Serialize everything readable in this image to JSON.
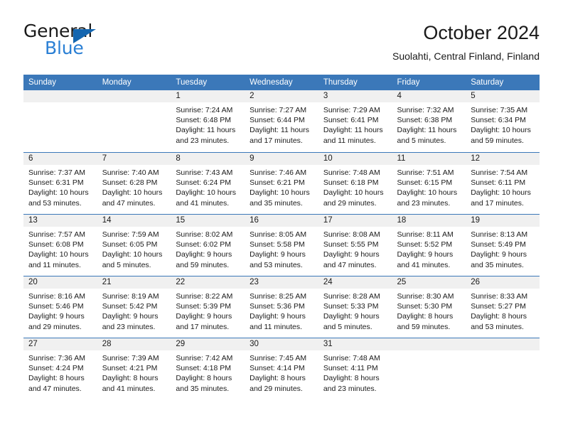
{
  "brand": {
    "line1": "General",
    "line2": "Blue",
    "triangle_icon": "brand-triangle-icon",
    "accent_color": "#2a7fd4",
    "triangle_color": "#1466b0"
  },
  "header": {
    "title": "October 2024",
    "subtitle": "Suolahti, Central Finland, Finland"
  },
  "calendar": {
    "header_bg_color": "#3b78b9",
    "daynum_band_color": "#f0f0f0",
    "weekday_headers": [
      "Sunday",
      "Monday",
      "Tuesday",
      "Wednesday",
      "Thursday",
      "Friday",
      "Saturday"
    ],
    "weeks": [
      [
        {
          "day": "",
          "sunrise": "",
          "sunset": "",
          "daylight_line1": "",
          "daylight_line2": ""
        },
        {
          "day": "",
          "sunrise": "",
          "sunset": "",
          "daylight_line1": "",
          "daylight_line2": ""
        },
        {
          "day": "1",
          "sunrise": "Sunrise: 7:24 AM",
          "sunset": "Sunset: 6:48 PM",
          "daylight_line1": "Daylight: 11 hours",
          "daylight_line2": "and 23 minutes."
        },
        {
          "day": "2",
          "sunrise": "Sunrise: 7:27 AM",
          "sunset": "Sunset: 6:44 PM",
          "daylight_line1": "Daylight: 11 hours",
          "daylight_line2": "and 17 minutes."
        },
        {
          "day": "3",
          "sunrise": "Sunrise: 7:29 AM",
          "sunset": "Sunset: 6:41 PM",
          "daylight_line1": "Daylight: 11 hours",
          "daylight_line2": "and 11 minutes."
        },
        {
          "day": "4",
          "sunrise": "Sunrise: 7:32 AM",
          "sunset": "Sunset: 6:38 PM",
          "daylight_line1": "Daylight: 11 hours",
          "daylight_line2": "and 5 minutes."
        },
        {
          "day": "5",
          "sunrise": "Sunrise: 7:35 AM",
          "sunset": "Sunset: 6:34 PM",
          "daylight_line1": "Daylight: 10 hours",
          "daylight_line2": "and 59 minutes."
        }
      ],
      [
        {
          "day": "6",
          "sunrise": "Sunrise: 7:37 AM",
          "sunset": "Sunset: 6:31 PM",
          "daylight_line1": "Daylight: 10 hours",
          "daylight_line2": "and 53 minutes."
        },
        {
          "day": "7",
          "sunrise": "Sunrise: 7:40 AM",
          "sunset": "Sunset: 6:28 PM",
          "daylight_line1": "Daylight: 10 hours",
          "daylight_line2": "and 47 minutes."
        },
        {
          "day": "8",
          "sunrise": "Sunrise: 7:43 AM",
          "sunset": "Sunset: 6:24 PM",
          "daylight_line1": "Daylight: 10 hours",
          "daylight_line2": "and 41 minutes."
        },
        {
          "day": "9",
          "sunrise": "Sunrise: 7:46 AM",
          "sunset": "Sunset: 6:21 PM",
          "daylight_line1": "Daylight: 10 hours",
          "daylight_line2": "and 35 minutes."
        },
        {
          "day": "10",
          "sunrise": "Sunrise: 7:48 AM",
          "sunset": "Sunset: 6:18 PM",
          "daylight_line1": "Daylight: 10 hours",
          "daylight_line2": "and 29 minutes."
        },
        {
          "day": "11",
          "sunrise": "Sunrise: 7:51 AM",
          "sunset": "Sunset: 6:15 PM",
          "daylight_line1": "Daylight: 10 hours",
          "daylight_line2": "and 23 minutes."
        },
        {
          "day": "12",
          "sunrise": "Sunrise: 7:54 AM",
          "sunset": "Sunset: 6:11 PM",
          "daylight_line1": "Daylight: 10 hours",
          "daylight_line2": "and 17 minutes."
        }
      ],
      [
        {
          "day": "13",
          "sunrise": "Sunrise: 7:57 AM",
          "sunset": "Sunset: 6:08 PM",
          "daylight_line1": "Daylight: 10 hours",
          "daylight_line2": "and 11 minutes."
        },
        {
          "day": "14",
          "sunrise": "Sunrise: 7:59 AM",
          "sunset": "Sunset: 6:05 PM",
          "daylight_line1": "Daylight: 10 hours",
          "daylight_line2": "and 5 minutes."
        },
        {
          "day": "15",
          "sunrise": "Sunrise: 8:02 AM",
          "sunset": "Sunset: 6:02 PM",
          "daylight_line1": "Daylight: 9 hours",
          "daylight_line2": "and 59 minutes."
        },
        {
          "day": "16",
          "sunrise": "Sunrise: 8:05 AM",
          "sunset": "Sunset: 5:58 PM",
          "daylight_line1": "Daylight: 9 hours",
          "daylight_line2": "and 53 minutes."
        },
        {
          "day": "17",
          "sunrise": "Sunrise: 8:08 AM",
          "sunset": "Sunset: 5:55 PM",
          "daylight_line1": "Daylight: 9 hours",
          "daylight_line2": "and 47 minutes."
        },
        {
          "day": "18",
          "sunrise": "Sunrise: 8:11 AM",
          "sunset": "Sunset: 5:52 PM",
          "daylight_line1": "Daylight: 9 hours",
          "daylight_line2": "and 41 minutes."
        },
        {
          "day": "19",
          "sunrise": "Sunrise: 8:13 AM",
          "sunset": "Sunset: 5:49 PM",
          "daylight_line1": "Daylight: 9 hours",
          "daylight_line2": "and 35 minutes."
        }
      ],
      [
        {
          "day": "20",
          "sunrise": "Sunrise: 8:16 AM",
          "sunset": "Sunset: 5:46 PM",
          "daylight_line1": "Daylight: 9 hours",
          "daylight_line2": "and 29 minutes."
        },
        {
          "day": "21",
          "sunrise": "Sunrise: 8:19 AM",
          "sunset": "Sunset: 5:42 PM",
          "daylight_line1": "Daylight: 9 hours",
          "daylight_line2": "and 23 minutes."
        },
        {
          "day": "22",
          "sunrise": "Sunrise: 8:22 AM",
          "sunset": "Sunset: 5:39 PM",
          "daylight_line1": "Daylight: 9 hours",
          "daylight_line2": "and 17 minutes."
        },
        {
          "day": "23",
          "sunrise": "Sunrise: 8:25 AM",
          "sunset": "Sunset: 5:36 PM",
          "daylight_line1": "Daylight: 9 hours",
          "daylight_line2": "and 11 minutes."
        },
        {
          "day": "24",
          "sunrise": "Sunrise: 8:28 AM",
          "sunset": "Sunset: 5:33 PM",
          "daylight_line1": "Daylight: 9 hours",
          "daylight_line2": "and 5 minutes."
        },
        {
          "day": "25",
          "sunrise": "Sunrise: 8:30 AM",
          "sunset": "Sunset: 5:30 PM",
          "daylight_line1": "Daylight: 8 hours",
          "daylight_line2": "and 59 minutes."
        },
        {
          "day": "26",
          "sunrise": "Sunrise: 8:33 AM",
          "sunset": "Sunset: 5:27 PM",
          "daylight_line1": "Daylight: 8 hours",
          "daylight_line2": "and 53 minutes."
        }
      ],
      [
        {
          "day": "27",
          "sunrise": "Sunrise: 7:36 AM",
          "sunset": "Sunset: 4:24 PM",
          "daylight_line1": "Daylight: 8 hours",
          "daylight_line2": "and 47 minutes."
        },
        {
          "day": "28",
          "sunrise": "Sunrise: 7:39 AM",
          "sunset": "Sunset: 4:21 PM",
          "daylight_line1": "Daylight: 8 hours",
          "daylight_line2": "and 41 minutes."
        },
        {
          "day": "29",
          "sunrise": "Sunrise: 7:42 AM",
          "sunset": "Sunset: 4:18 PM",
          "daylight_line1": "Daylight: 8 hours",
          "daylight_line2": "and 35 minutes."
        },
        {
          "day": "30",
          "sunrise": "Sunrise: 7:45 AM",
          "sunset": "Sunset: 4:14 PM",
          "daylight_line1": "Daylight: 8 hours",
          "daylight_line2": "and 29 minutes."
        },
        {
          "day": "31",
          "sunrise": "Sunrise: 7:48 AM",
          "sunset": "Sunset: 4:11 PM",
          "daylight_line1": "Daylight: 8 hours",
          "daylight_line2": "and 23 minutes."
        },
        {
          "day": "",
          "sunrise": "",
          "sunset": "",
          "daylight_line1": "",
          "daylight_line2": ""
        },
        {
          "day": "",
          "sunrise": "",
          "sunset": "",
          "daylight_line1": "",
          "daylight_line2": ""
        }
      ]
    ]
  }
}
